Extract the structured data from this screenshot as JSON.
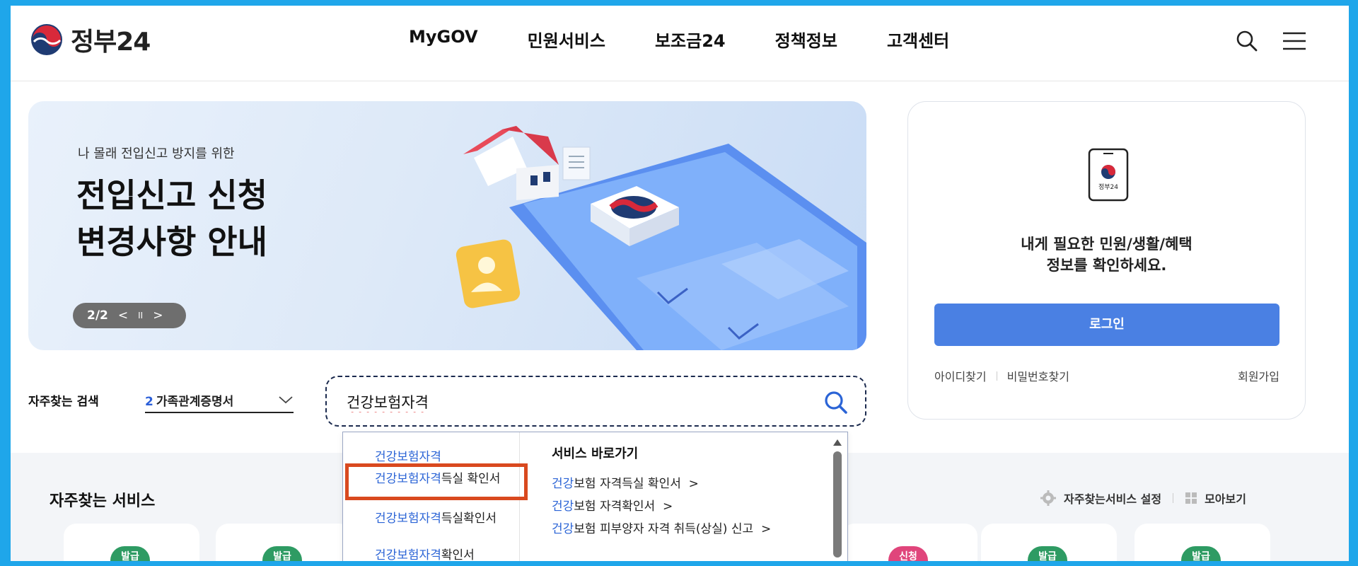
{
  "header": {
    "logo_text": "정부24",
    "nav": [
      "MyGOV",
      "민원서비스",
      "보조금24",
      "정책정보",
      "고객센터"
    ]
  },
  "banner": {
    "subtitle": "나 몰래 전입신고 방지를 위한",
    "title_line1": "전입신고 신청",
    "title_line2": "변경사항 안내",
    "page_indicator": "2/2",
    "prev_symbol": "<",
    "pause_symbol": "II",
    "next_symbol": ">"
  },
  "login": {
    "phone_label": "정부24",
    "message_line1": "내게 필요한 민원/생활/혜택",
    "message_line2": "정보를 확인하세요.",
    "login_button": "로그인",
    "find_id": "아이디찾기",
    "find_password": "비밀번호찾기",
    "signup": "회원가입"
  },
  "search": {
    "fav_label": "자주찾는 검색",
    "fav_selected_num": "2",
    "fav_selected_text": "가족관계증명서",
    "input_value": "건강보험자격"
  },
  "autocomplete": {
    "suggestions": [
      {
        "hl": "건강보험자격",
        "rest": ""
      },
      {
        "hl": "건강보험자격",
        "rest": "득실 확인서"
      },
      {
        "hl": "건강보험자격",
        "rest": "득실확인서"
      },
      {
        "hl": "건강보험자격",
        "rest": "확인서"
      }
    ],
    "shortcut_title": "서비스 바로가기",
    "shortcuts": [
      {
        "hl": "건강",
        "rest": "보험 자격득실 확인서",
        "arrow": ">"
      },
      {
        "hl": "건강",
        "rest": "보험 자격확인서",
        "arrow": ">"
      },
      {
        "hl": "건강",
        "rest": "보험 피부양자 자격 취득(상실) 신고",
        "arrow": ">"
      }
    ]
  },
  "frequent_services": {
    "title": "자주찾는 서비스",
    "settings_link": "자주찾는서비스 설정",
    "view_all_link": "모아보기",
    "badges": [
      "발급",
      "발급",
      "신청",
      "발급",
      "발급"
    ],
    "badge_colors": {
      "issue": "#2e9b63",
      "apply": "#e0457b"
    }
  },
  "colors": {
    "frame_border": "#1fa6ea",
    "primary": "#4a80e3",
    "link_blue": "#2b64d6",
    "highlight_box": "#d9491f"
  }
}
